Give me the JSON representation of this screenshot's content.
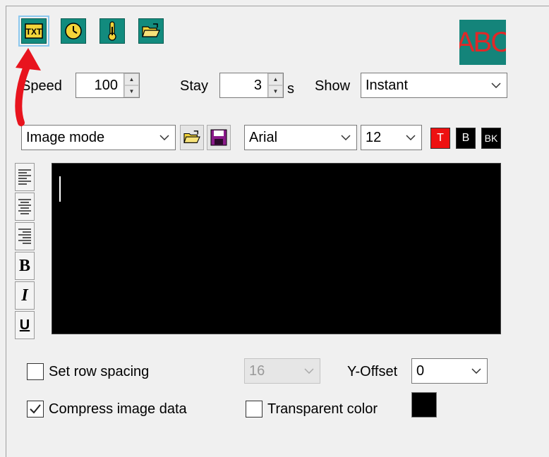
{
  "toolbar": {
    "items": [
      {
        "icon": "text-icon",
        "glyph": "TXT"
      },
      {
        "icon": "clock-icon"
      },
      {
        "icon": "thermometer-icon"
      },
      {
        "icon": "open-folder-icon"
      }
    ]
  },
  "preview": {
    "text": "ABC",
    "bg_color": "#14847a",
    "fg_color": "#e02828"
  },
  "speed": {
    "label": "Speed",
    "value": "100"
  },
  "stay": {
    "label": "Stay",
    "value": "3",
    "unit": "s"
  },
  "show": {
    "label": "Show",
    "selected": "Instant"
  },
  "mode": {
    "selected": "Image mode"
  },
  "font": {
    "family": "Arial",
    "size": "12"
  },
  "color_buttons": [
    {
      "label": "T",
      "color": "#ee1111"
    },
    {
      "label": "B",
      "color": "#000000"
    },
    {
      "label": "BK",
      "color": "#000000"
    }
  ],
  "format_buttons": {
    "bold": "B",
    "italic": "I",
    "underline": "U"
  },
  "options": {
    "row_spacing_label": "Set row spacing",
    "row_spacing_checked": false,
    "row_spacing_value": "16",
    "y_offset_label": "Y-Offset",
    "y_offset_value": "0",
    "compress_label": "Compress image data",
    "compress_checked": true,
    "transparent_label": "Transparent color",
    "transparent_checked": false,
    "transparent_color": "#000000"
  }
}
